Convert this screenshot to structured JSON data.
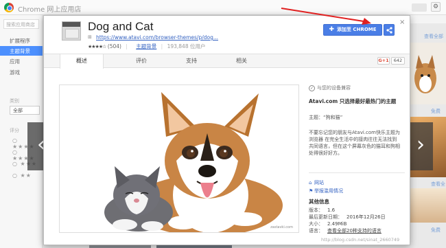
{
  "store": {
    "title": "Chrome 网上应用店",
    "search_placeholder": "搜索应用商店",
    "nav": [
      "扩展程序",
      "主题背景",
      "应用",
      "游戏"
    ],
    "category_label": "类别",
    "category_value": "全部",
    "rating_label": "评分",
    "right_labels": [
      "查看全部",
      "免费",
      "查看全部",
      "免费",
      "免费"
    ]
  },
  "modal": {
    "title": "Dog and Cat",
    "url": "https://www.atavi.com/browser-themes/p/dog...",
    "rating_count": "(504)",
    "stars": "★★★★☆",
    "category": "主题背景",
    "users": "193,848 位用户",
    "add_button": "添加至 CHROME",
    "close": "×",
    "tabs": [
      "概述",
      "评价",
      "支持",
      "相关"
    ],
    "gplus_label": "G+1",
    "gplus_count": "642",
    "screenshot_watermark": "zastavki.com",
    "info": {
      "compat": "与您的设备兼容",
      "desc_title": "Atavi.com 只选择最好最热门的主题",
      "theme_line": "主题：“狗和猫”",
      "desc_body": "不要忘记您的朋友与Atavi.com快乐主题为浏览器 在完全生活中的接肉往往无法找到共同语言，但在这个屏幕灰色的猫耳和狗相处得很好好方。",
      "website": "网站",
      "report": "举报滥用情况",
      "more_title": "其他信息",
      "version_label": "版本：",
      "version": "1.6",
      "updated_label": "最后更新日期：",
      "updated": "2016年12月26日",
      "size_label": "大小：",
      "size": "2.49MiB",
      "language_label": "语言：",
      "language": "查看全部20种支持的语言"
    }
  },
  "footer_watermark": "http://blog.csdn.net/sinat_2660749"
}
